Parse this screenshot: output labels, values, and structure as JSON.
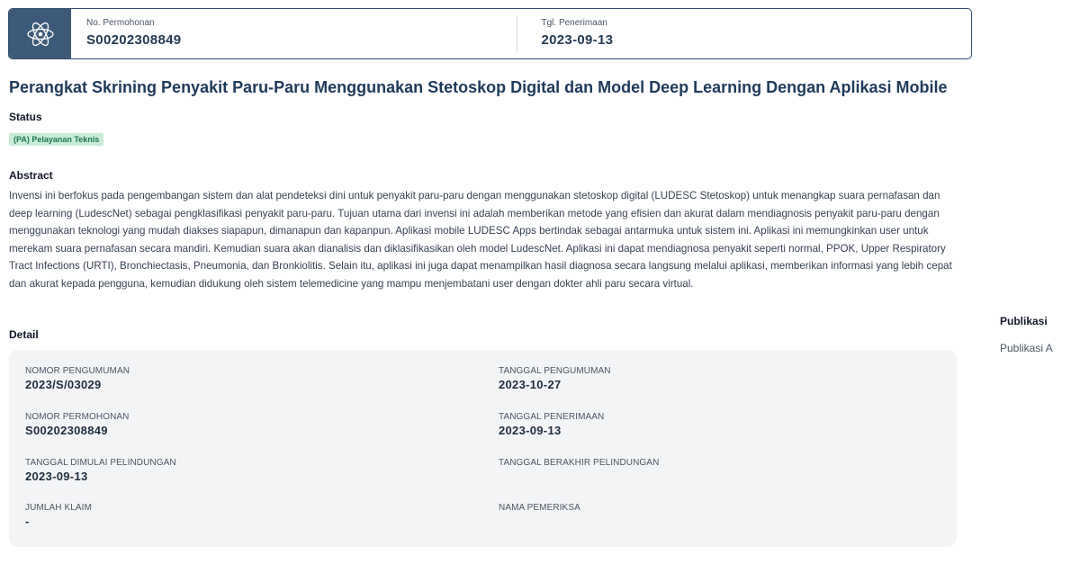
{
  "header": {
    "icon": "atom-icon",
    "no_permohonan_label": "No. Permohonan",
    "no_permohonan_value": "S00202308849",
    "tgl_penerimaan_label": "Tgl. Penerimaan",
    "tgl_penerimaan_value": "2023-09-13"
  },
  "title": "Perangkat Skrining Penyakit Paru-Paru Menggunakan Stetoskop Digital dan Model Deep Learning Dengan Aplikasi Mobile",
  "status": {
    "label": "Status",
    "badge": "(PA) Pelayanan Teknis"
  },
  "abstract": {
    "label": "Abstract",
    "text": "Invensi ini berfokus pada pengembangan sistem dan alat pendeteksi dini untuk penyakit paru-paru dengan menggunakan stetoskop digital (LUDESC Stetoskop) untuk menangkap suara pernafasan dan deep learning (LudescNet) sebagai pengklasifikasi penyakit paru-paru. Tujuan utama dari invensi ini adalah memberikan metode yang efisien dan akurat dalam mendiagnosis penyakit paru-paru dengan menggunakan teknologi yang mudah diakses siapapun, dimanapun dan kapanpun. Aplikasi mobile LUDESC Apps bertindak sebagai antarmuka untuk sistem ini. Aplikasi ini memungkinkan user untuk merekam suara pernafasan secara mandiri. Kemudian suara akan dianalisis dan diklasifikasikan oleh model LudescNet. Aplikasi ini dapat mendiagnosa penyakit seperti normal, PPOK, Upper Respiratory Tract Infections (URTI), Bronchiectasis, Pneumonia, dan Bronkiolitis. Selain itu, aplikasi ini juga dapat menampilkan hasil diagnosa secara langsung melalui aplikasi, memberikan informasi yang lebih cepat dan akurat kepada pengguna, kemudian didukung oleh sistem telemedicine yang mampu menjembatani user dengan dokter ahli paru secara virtual."
  },
  "detail": {
    "label": "Detail",
    "nomor_pengumuman_label": "NOMOR PENGUMUMAN",
    "nomor_pengumuman_value": "2023/S/03029",
    "tanggal_pengumuman_label": "TANGGAL PENGUMUMAN",
    "tanggal_pengumuman_value": "2023-10-27",
    "nomor_permohonan_label": "NOMOR PERMOHONAN",
    "nomor_permohonan_value": "S00202308849",
    "tanggal_penerimaan_label": "TANGGAL PENERIMAAN",
    "tanggal_penerimaan_value": "2023-09-13",
    "tanggal_dimulai_label": "TANGGAL DIMULAI PELINDUNGAN",
    "tanggal_dimulai_value": "2023-09-13",
    "tanggal_berakhir_label": "TANGGAL BERAKHIR PELINDUNGAN",
    "tanggal_berakhir_value": "",
    "jumlah_klaim_label": "JUMLAH KLAIM",
    "jumlah_klaim_value": "-",
    "nama_pemeriksa_label": "NAMA PEMERIKSA",
    "nama_pemeriksa_value": ""
  },
  "publikasi": {
    "heading": "Publikasi",
    "item": "Publikasi A"
  },
  "colors": {
    "header_icon_bg": "#3c5a78",
    "title": "#1e3a5a",
    "badge_bg": "#c9ecd9",
    "badge_text": "#20744a",
    "detail_bg": "#f3f4f6"
  }
}
